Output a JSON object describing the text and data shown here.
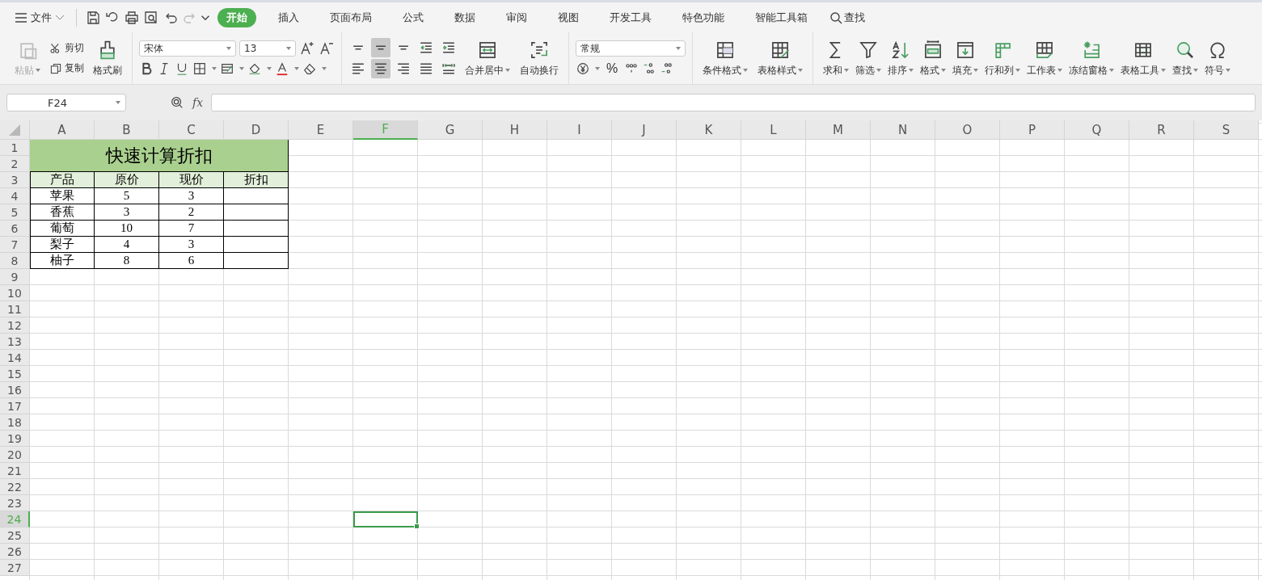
{
  "menu": {
    "file_label": "文件",
    "tabs": [
      {
        "label": "开始",
        "selected": true
      },
      {
        "label": "插入",
        "selected": false
      },
      {
        "label": "页面布局",
        "selected": false
      },
      {
        "label": "公式",
        "selected": false
      },
      {
        "label": "数据",
        "selected": false
      },
      {
        "label": "审阅",
        "selected": false
      },
      {
        "label": "视图",
        "selected": false
      },
      {
        "label": "开发工具",
        "selected": false
      },
      {
        "label": "特色功能",
        "selected": false
      },
      {
        "label": "智能工具箱",
        "selected": false
      }
    ],
    "search": "查找"
  },
  "ribbon": {
    "paste": {
      "label": "粘贴",
      "disabled": true
    },
    "cut": "剪切",
    "copy": "复制",
    "format_painter": "格式刷",
    "font": {
      "family": "宋体",
      "size": "13"
    },
    "align_buttons": [
      {
        "selected": false
      },
      {
        "selected": true
      },
      {
        "selected": false
      },
      {
        "selected": false
      },
      {
        "selected": false
      },
      {
        "selected": false
      },
      {
        "selected": true
      },
      {
        "selected": false
      },
      {
        "selected": false
      },
      {
        "selected": false
      }
    ],
    "merge": "合并居中",
    "wrap": "自动换行",
    "number_format": "常规",
    "percent": "%",
    "style_buttons": [
      {
        "label": "条件格式",
        "dropdown": true
      },
      {
        "label": "表格样式",
        "dropdown": true
      }
    ],
    "tools": [
      {
        "label": "求和",
        "dropdown": true
      },
      {
        "label": "筛选",
        "dropdown": true
      },
      {
        "label": "排序",
        "dropdown": true
      },
      {
        "label": "格式",
        "dropdown": true
      },
      {
        "label": "填充",
        "dropdown": true
      },
      {
        "label": "行和列",
        "dropdown": true
      },
      {
        "label": "工作表",
        "dropdown": true
      },
      {
        "label": "冻结窗格",
        "dropdown": true
      },
      {
        "label": "表格工具",
        "dropdown": true
      },
      {
        "label": "查找",
        "dropdown": true
      },
      {
        "label": "符号",
        "dropdown": true
      }
    ]
  },
  "formula_bar": {
    "name_box": "F24",
    "fx": "fx"
  },
  "sheet": {
    "columns": [
      {
        "label": "A",
        "selected": false
      },
      {
        "label": "B",
        "selected": false
      },
      {
        "label": "C",
        "selected": false
      },
      {
        "label": "D",
        "selected": false
      },
      {
        "label": "E",
        "selected": false
      },
      {
        "label": "F",
        "selected": true
      },
      {
        "label": "G",
        "selected": false
      },
      {
        "label": "H",
        "selected": false
      },
      {
        "label": "I",
        "selected": false
      },
      {
        "label": "J",
        "selected": false
      },
      {
        "label": "K",
        "selected": false
      },
      {
        "label": "L",
        "selected": false
      },
      {
        "label": "M",
        "selected": false
      },
      {
        "label": "N",
        "selected": false
      },
      {
        "label": "O",
        "selected": false
      },
      {
        "label": "P",
        "selected": false
      },
      {
        "label": "Q",
        "selected": false
      },
      {
        "label": "R",
        "selected": false
      },
      {
        "label": "S",
        "selected": false
      }
    ],
    "rows": [
      {
        "label": "1",
        "selected": false
      },
      {
        "label": "2",
        "selected": false
      },
      {
        "label": "3",
        "selected": false
      },
      {
        "label": "4",
        "selected": false
      },
      {
        "label": "5",
        "selected": false
      },
      {
        "label": "6",
        "selected": false
      },
      {
        "label": "7",
        "selected": false
      },
      {
        "label": "8",
        "selected": false
      },
      {
        "label": "9",
        "selected": false
      },
      {
        "label": "10",
        "selected": false
      },
      {
        "label": "11",
        "selected": false
      },
      {
        "label": "12",
        "selected": false
      },
      {
        "label": "13",
        "selected": false
      },
      {
        "label": "14",
        "selected": false
      },
      {
        "label": "15",
        "selected": false
      },
      {
        "label": "16",
        "selected": false
      },
      {
        "label": "17",
        "selected": false
      },
      {
        "label": "18",
        "selected": false
      },
      {
        "label": "19",
        "selected": false
      },
      {
        "label": "20",
        "selected": false
      },
      {
        "label": "21",
        "selected": false
      },
      {
        "label": "22",
        "selected": false
      },
      {
        "label": "23",
        "selected": false
      },
      {
        "label": "24",
        "selected": true
      },
      {
        "label": "25",
        "selected": false
      },
      {
        "label": "26",
        "selected": false
      },
      {
        "label": "27",
        "selected": false
      }
    ],
    "table": {
      "title": "快速计算折扣",
      "headers": [
        "产品",
        "原价",
        "现价",
        "折扣"
      ],
      "rows": [
        [
          "苹果",
          "5",
          "3"
        ],
        [
          "香蕉",
          "3",
          "2"
        ],
        [
          "葡萄",
          "10",
          "7"
        ],
        [
          "梨子",
          "4",
          "3"
        ],
        [
          "柚子",
          "8",
          "6"
        ]
      ]
    }
  }
}
